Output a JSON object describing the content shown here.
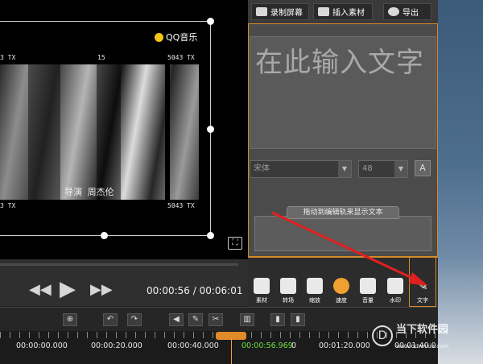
{
  "toolbar": {
    "record_label": "录制屏幕",
    "insert_label": "插入素材",
    "export_label": "导出"
  },
  "preview": {
    "logo_text": "QQ音乐",
    "overlay_labels": [
      "3 TX",
      "15",
      "5043 TX",
      "3 TX",
      "5043 TX"
    ],
    "subtitle_text": "导演 周杰伦"
  },
  "playback": {
    "current_time": "00:00:56",
    "total_time": "00:06:01",
    "separator": " / "
  },
  "text_editor": {
    "placeholder": "在此输入文字",
    "font_name": "宋体",
    "font_size": "48",
    "font_color_glyph": "A",
    "drag_tip": "拖动到编辑轨来显示文本"
  },
  "tools": [
    {
      "label": "素材",
      "icon": "media-icon"
    },
    {
      "label": "转场",
      "icon": "transition-icon"
    },
    {
      "label": "缩放",
      "icon": "zoom-icon"
    },
    {
      "label": "速度",
      "icon": "speed-icon"
    },
    {
      "label": "音量",
      "icon": "volume-icon"
    },
    {
      "label": "水印",
      "icon": "watermark-icon"
    },
    {
      "label": "文字",
      "icon": "pen-icon"
    }
  ],
  "timeline": {
    "ticks": [
      "00:00:00.000",
      "00:00:20.000",
      "00:00:40.000",
      "0",
      "00:01:20.000",
      "00:01:40.0"
    ],
    "playhead_time": "00:00:56.969"
  },
  "watermark": {
    "title": "当下软件园",
    "sub": "www.downxia.com"
  },
  "colors": {
    "accent_orange": "#d48a2a",
    "playhead_green": "#6ce040",
    "arrow_red": "#e02020"
  }
}
